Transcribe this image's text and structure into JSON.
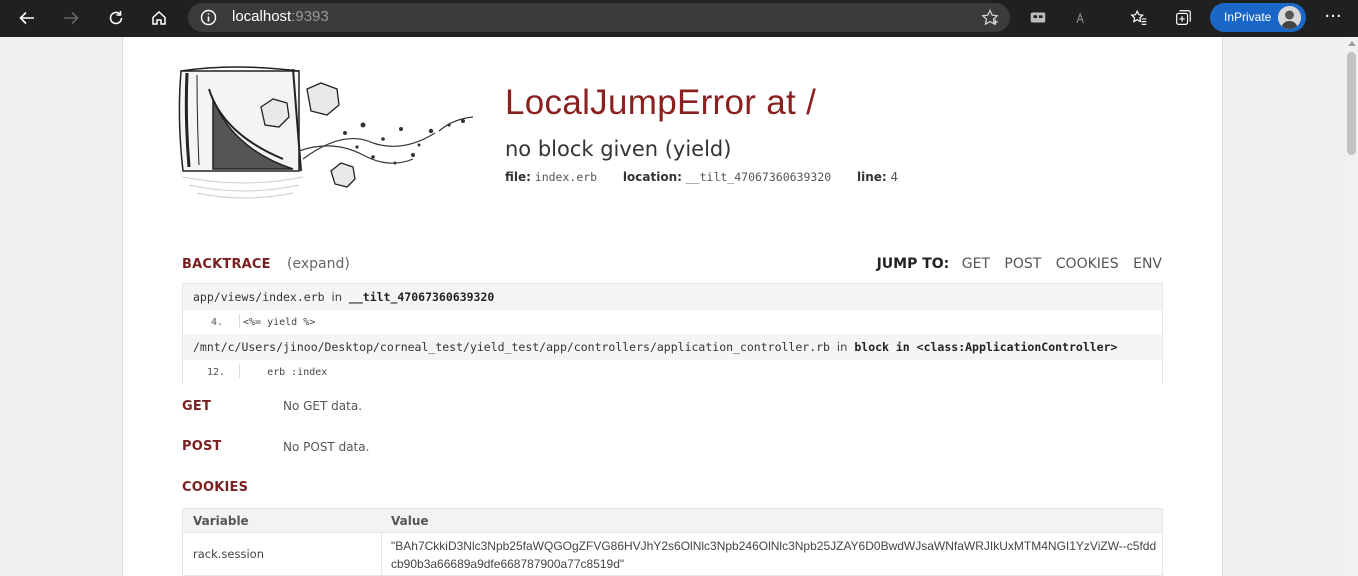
{
  "browser": {
    "url_host": "localhost",
    "url_port": ":9393",
    "inprivate_label": "InPrivate"
  },
  "error": {
    "title": "LocalJumpError at /",
    "message": "no block given (yield)",
    "file_label": "file:",
    "file_value": "index.erb",
    "location_label": "location:",
    "location_value": "__tilt_47067360639320",
    "line_label": "line:",
    "line_value": "4"
  },
  "backtrace": {
    "heading": "BACKTRACE",
    "expand_label": "(expand)",
    "jump_to_label": "JUMP TO:",
    "jump_links": [
      "GET",
      "POST",
      "COOKIES",
      "ENV"
    ],
    "frames": [
      {
        "file": "app/views/index.erb",
        "in": "in",
        "context": "__tilt_47067360639320",
        "line_no": "4.",
        "code": "<%= yield %>"
      },
      {
        "file": "/mnt/c/Users/jinoo/Desktop/corneal_test/yield_test/app/controllers/application_controller.rb",
        "in": "in",
        "context": "block in <class:ApplicationController>",
        "line_no": "12.",
        "code": "    erb :index"
      }
    ]
  },
  "get": {
    "heading": "GET",
    "text": "No GET data."
  },
  "post": {
    "heading": "POST",
    "text": "No POST data."
  },
  "cookies": {
    "heading": "COOKIES",
    "col_variable": "Variable",
    "col_value": "Value",
    "rows": [
      {
        "variable": "rack.session",
        "value": "\"BAh7CkkiD3Nlc3Npb25faWQGOgZFVG86HVJhY2s6OlNlc3Npb246OlNlc3Npb25JZAY6D0BwdWJsaWNfaWRJIkUxMTM4NGI1YzViZW--c5fddcb90b3a66689a9dfe668787900a77c8519d\""
      }
    ]
  },
  "colors": {
    "accent": "#8a2020",
    "chrome": "#202020",
    "inprivate": "#1a67c7"
  }
}
